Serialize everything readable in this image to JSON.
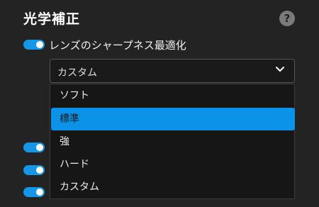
{
  "section": {
    "title": "光学補正",
    "help_icon": "question-icon",
    "help_symbol": "?"
  },
  "lens_sharpness": {
    "label": "レンズのシャープネス最適化",
    "enabled": true
  },
  "sharpness_select": {
    "value": "カスタム",
    "options": [
      {
        "label": "ソフト",
        "selected": false
      },
      {
        "label": "標準",
        "selected": true
      },
      {
        "label": "強",
        "selected": false
      },
      {
        "label": "ハード",
        "selected": false
      },
      {
        "label": "カスタム",
        "selected": false
      }
    ]
  },
  "other_toggles": [
    {
      "enabled": true
    },
    {
      "enabled": true
    },
    {
      "enabled": true
    }
  ],
  "colors": {
    "accent": "#1596e8",
    "highlight": "#0b93ea",
    "background": "#232323"
  }
}
